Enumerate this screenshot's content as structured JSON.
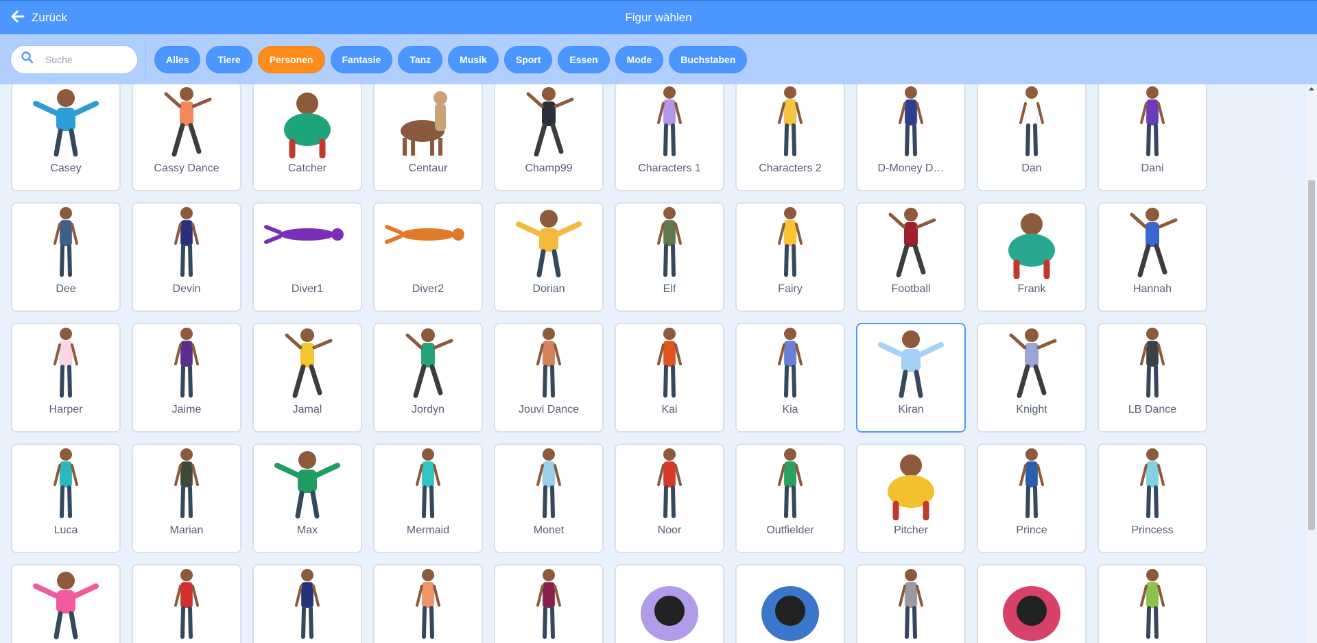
{
  "header": {
    "back_label": "Zurück",
    "title": "Figur wählen"
  },
  "search": {
    "placeholder": "Suche",
    "value": ""
  },
  "tags": [
    {
      "label": "Alles",
      "active": false
    },
    {
      "label": "Tiere",
      "active": false
    },
    {
      "label": "Personen",
      "active": true
    },
    {
      "label": "Fantasie",
      "active": false
    },
    {
      "label": "Tanz",
      "active": false
    },
    {
      "label": "Musik",
      "active": false
    },
    {
      "label": "Sport",
      "active": false
    },
    {
      "label": "Essen",
      "active": false
    },
    {
      "label": "Mode",
      "active": false
    },
    {
      "label": "Buchstaben",
      "active": false
    }
  ],
  "sprites": [
    {
      "name": "Casey",
      "color": "#2e9cd6",
      "pose": "wide"
    },
    {
      "name": "Cassy Dance",
      "color": "#f08a5d",
      "pose": "dance"
    },
    {
      "name": "Catcher",
      "color": "#1fa37a",
      "pose": "squat"
    },
    {
      "name": "Centaur",
      "color": "#8a5a3c",
      "pose": "horse"
    },
    {
      "name": "Champ99",
      "color": "#2b2f3a",
      "pose": "dance"
    },
    {
      "name": "Characters 1",
      "color": "#b497e8",
      "pose": "stand"
    },
    {
      "name": "Characters 2",
      "color": "#f5c542",
      "pose": "stand"
    },
    {
      "name": "D-Money D…",
      "color": "#2c3e8f",
      "pose": "stand"
    },
    {
      "name": "Dan",
      "color": "#ffffff",
      "pose": "stand"
    },
    {
      "name": "Dani",
      "color": "#6a3db8",
      "pose": "stand"
    },
    {
      "name": "Dee",
      "color": "#3f5f8a",
      "pose": "stand"
    },
    {
      "name": "Devin",
      "color": "#2c2f7a",
      "pose": "stand"
    },
    {
      "name": "Diver1",
      "color": "#7a2fb8",
      "pose": "dive"
    },
    {
      "name": "Diver2",
      "color": "#e07a2a",
      "pose": "dive"
    },
    {
      "name": "Dorian",
      "color": "#f4b93d",
      "pose": "wide"
    },
    {
      "name": "Elf",
      "color": "#5f7a4a",
      "pose": "stand"
    },
    {
      "name": "Fairy",
      "color": "#f7c531",
      "pose": "stand"
    },
    {
      "name": "Football",
      "color": "#a01f2a",
      "pose": "dance"
    },
    {
      "name": "Frank",
      "color": "#2aa88f",
      "pose": "squat"
    },
    {
      "name": "Hannah",
      "color": "#3a67d4",
      "pose": "dance"
    },
    {
      "name": "Harper",
      "color": "#f7d7e3",
      "pose": "stand"
    },
    {
      "name": "Jaime",
      "color": "#5a2e91",
      "pose": "stand"
    },
    {
      "name": "Jamal",
      "color": "#f2c72e",
      "pose": "dance"
    },
    {
      "name": "Jordyn",
      "color": "#27a37a",
      "pose": "dance"
    },
    {
      "name": "Jouvi Dance",
      "color": "#d4825a",
      "pose": "stand"
    },
    {
      "name": "Kai",
      "color": "#e0551c",
      "pose": "stand"
    },
    {
      "name": "Kia",
      "color": "#6a7fd6",
      "pose": "stand"
    },
    {
      "name": "Kiran",
      "color": "#a6d0f5",
      "pose": "wide"
    },
    {
      "name": "Knight",
      "color": "#9aa6d8",
      "pose": "dance"
    },
    {
      "name": "LB Dance",
      "color": "#3b3f46",
      "pose": "stand"
    },
    {
      "name": "Luca",
      "color": "#27b8c0",
      "pose": "stand"
    },
    {
      "name": "Marian",
      "color": "#3d4a3a",
      "pose": "stand"
    },
    {
      "name": "Max",
      "color": "#1f9e63",
      "pose": "wide"
    },
    {
      "name": "Mermaid",
      "color": "#31c6c6",
      "pose": "stand"
    },
    {
      "name": "Monet",
      "color": "#9ad0ee",
      "pose": "stand"
    },
    {
      "name": "Noor",
      "color": "#d83a2a",
      "pose": "stand"
    },
    {
      "name": "Outfielder",
      "color": "#27a35f",
      "pose": "stand"
    },
    {
      "name": "Pitcher",
      "color": "#f2c22e",
      "pose": "squat"
    },
    {
      "name": "Prince",
      "color": "#2a5fb0",
      "pose": "stand"
    },
    {
      "name": "Princess",
      "color": "#7fd3e0",
      "pose": "stand"
    },
    {
      "name": "",
      "color": "#f25aa0",
      "pose": "wide"
    },
    {
      "name": "",
      "color": "#d42f2f",
      "pose": "stand"
    },
    {
      "name": "",
      "color": "#23327a",
      "pose": "stand"
    },
    {
      "name": "",
      "color": "#f0956a",
      "pose": "stand"
    },
    {
      "name": "",
      "color": "#8a1f4a",
      "pose": "stand"
    },
    {
      "name": "",
      "color": "#b09ce8",
      "pose": "top"
    },
    {
      "name": "",
      "color": "#3a76c9",
      "pose": "top"
    },
    {
      "name": "",
      "color": "#9a9aa0",
      "pose": "stand"
    },
    {
      "name": "",
      "color": "#d8416a",
      "pose": "top"
    },
    {
      "name": "",
      "color": "#8bc34a",
      "pose": "stand"
    }
  ],
  "selected": "Kiran"
}
